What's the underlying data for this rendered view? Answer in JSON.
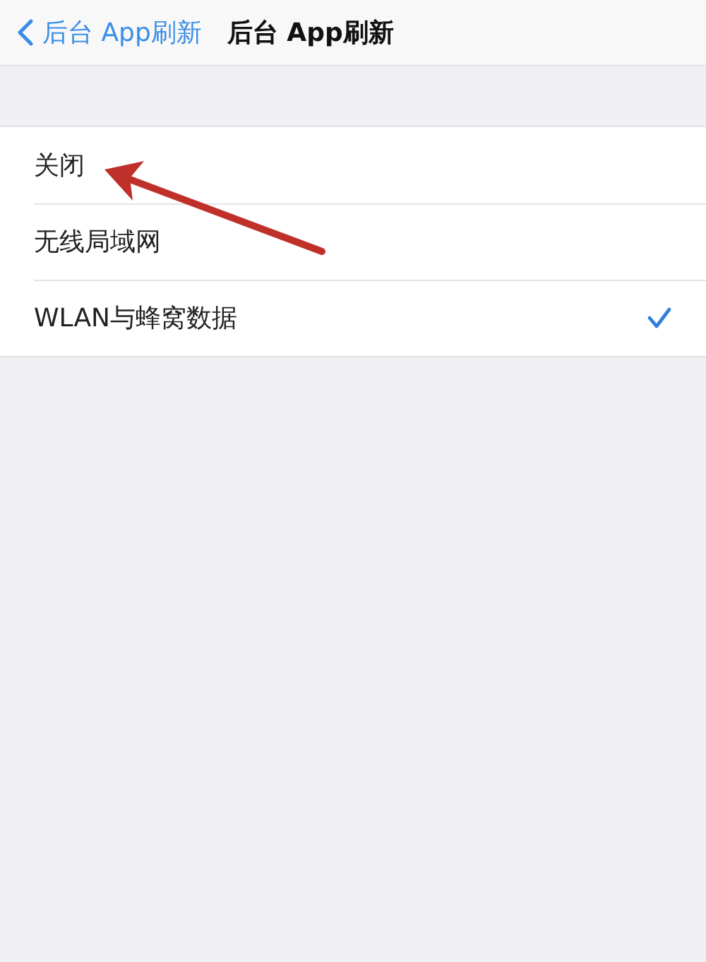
{
  "nav_bar": {
    "back_label": "后台 App刷新",
    "title": "后台 App刷新"
  },
  "options": [
    {
      "label": "关闭",
      "selected": false
    },
    {
      "label": "无线局域网",
      "selected": false
    },
    {
      "label": "WLAN与蜂窝数据",
      "selected": true
    }
  ],
  "annotation": {
    "kind": "arrow"
  }
}
